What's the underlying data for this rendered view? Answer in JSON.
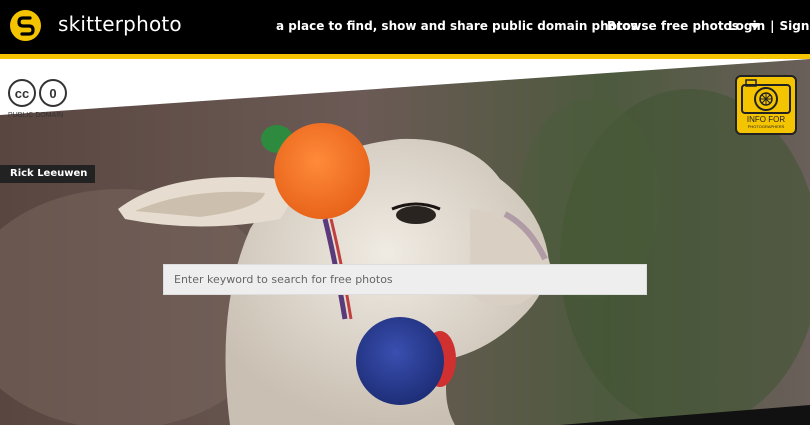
{
  "header": {
    "logo_text": "skitterphoto",
    "tagline": "a place to find, show and share public domain photos",
    "browse_label": "Browse free photos",
    "login_label": "Login",
    "separator": "|",
    "signup_label": "Signup"
  },
  "license": {
    "label": "PUBLIC DOMAIN",
    "cc_text": "cc",
    "zero_text": "0"
  },
  "photo": {
    "photographer": "Rick Leeuwen"
  },
  "badge": {
    "line1": "INFO FOR",
    "line2": "PHOTOGRAPHERS"
  },
  "search": {
    "placeholder": "Enter keyword to search for free photos"
  },
  "colors": {
    "brand_yellow": "#f5c400",
    "header_bg": "#000000"
  }
}
